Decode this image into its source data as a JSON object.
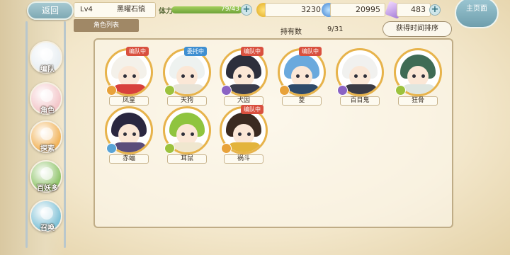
{
  "header": {
    "back_label": "返回",
    "level": "Lv4",
    "player_name": "黑曜石镐",
    "stamina_label": "体力",
    "stamina_text": "79/43",
    "stamina_fraction": 1.0,
    "gold": "3230",
    "gems": "20995",
    "tickets": "483",
    "home_label": "主页面"
  },
  "tab": {
    "label": "角色列表"
  },
  "owned": {
    "label": "持有数",
    "count": "9/31"
  },
  "sort": {
    "label": "获得时间排序"
  },
  "side_nav": [
    {
      "label": "编队",
      "icon": "team-icon",
      "color": "#e8eef2"
    },
    {
      "label": "角色",
      "icon": "character-icon",
      "color": "#f3c6c9"
    },
    {
      "label": "探索",
      "icon": "explore-icon",
      "color": "#f1b35a"
    },
    {
      "label": "百妖多",
      "icon": "monster-icon",
      "color": "#8fc46a"
    },
    {
      "label": "召唤",
      "icon": "summon-icon",
      "color": "#7fc1d6"
    }
  ],
  "characters": [
    {
      "name": "凤皇",
      "badge": "编队中",
      "badge_color": "#d9503f",
      "element_color": "#e8a23a",
      "hair": "#f4f1ea",
      "cloth": "#d8403b"
    },
    {
      "name": "天狗",
      "badge": "委托中",
      "badge_color": "#3f8fd1",
      "element_color": "#9cc23d",
      "hair": "#eef2f0",
      "cloth": "#e7e3d7"
    },
    {
      "name": "犬因",
      "badge": "编队中",
      "badge_color": "#d9503f",
      "element_color": "#8a63c4",
      "hair": "#2d2f3c",
      "cloth": "#3a3c4c"
    },
    {
      "name": "菱",
      "badge": "编队中",
      "badge_color": "#d9503f",
      "element_color": "#e8a23a",
      "hair": "#6aa9dd",
      "cloth": "#2f4a6a"
    },
    {
      "name": "百目鬼",
      "badge": "",
      "badge_color": "#d9503f",
      "element_color": "#8a63c4",
      "hair": "#f1f1ef",
      "cloth": "#3b3b45"
    },
    {
      "name": "狂骨",
      "badge": "",
      "badge_color": "#d9503f",
      "element_color": "#9cc23d",
      "hair": "#3f6b55",
      "cloth": "#dfe6e0"
    },
    {
      "name": "赤蝠",
      "badge": "",
      "badge_color": "#d9503f",
      "element_color": "#5aa4d6",
      "hair": "#2a2740",
      "cloth": "#5b4d7a"
    },
    {
      "name": "耳鼠",
      "badge": "",
      "badge_color": "#d9503f",
      "element_color": "#9cc23d",
      "hair": "#8fc43f",
      "cloth": "#f0e7cf"
    },
    {
      "name": "祸斗",
      "badge": "编队中",
      "badge_color": "#d9503f",
      "element_color": "#e8a23a",
      "hair": "#3b2a20",
      "cloth": "#e3b43c"
    }
  ]
}
